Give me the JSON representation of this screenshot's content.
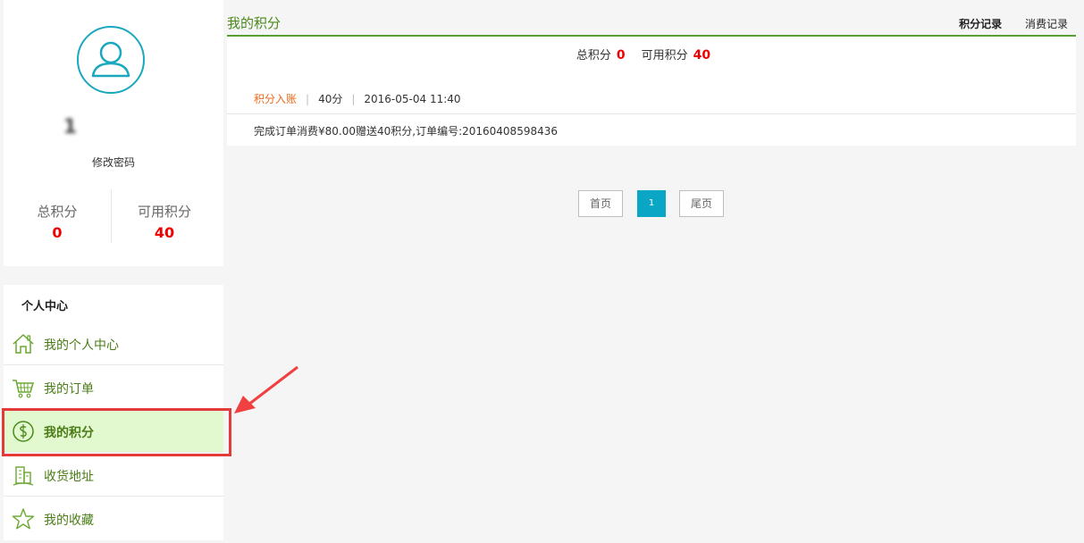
{
  "profile": {
    "username": "1        ",
    "change_password": "修改密码",
    "total_label": "总积分",
    "total_value": "0",
    "available_label": "可用积分",
    "available_value": "40"
  },
  "menu": {
    "title": "个人中心",
    "items": [
      {
        "label": "我的个人中心",
        "icon": "home-icon"
      },
      {
        "label": "我的订单",
        "icon": "cart-icon"
      },
      {
        "label": "我的积分",
        "icon": "dollar-icon"
      },
      {
        "label": "收货地址",
        "icon": "building-icon"
      },
      {
        "label": "我的收藏",
        "icon": "star-icon"
      }
    ],
    "active_index": 2
  },
  "main": {
    "title": "我的积分",
    "tabs": [
      "积分记录",
      "消费记录"
    ],
    "totals": {
      "total_label": "总积分",
      "total_value": "0",
      "available_label": "可用积分",
      "available_value": "40"
    },
    "record": {
      "type": "积分入账",
      "points": "40分",
      "datetime": "2016-05-04 11:40",
      "description": "完成订单消费¥80.00赠送40积分,订单编号:20160408598436"
    }
  },
  "pager": {
    "first": "首页",
    "current": "1",
    "last": "尾页"
  },
  "colors": {
    "accent_green": "#4a8a1c",
    "accent_cyan": "#1aa8bf",
    "value_red": "#e00000",
    "highlight_red": "#e33a3a",
    "active_bg": "#e2f8cf"
  }
}
